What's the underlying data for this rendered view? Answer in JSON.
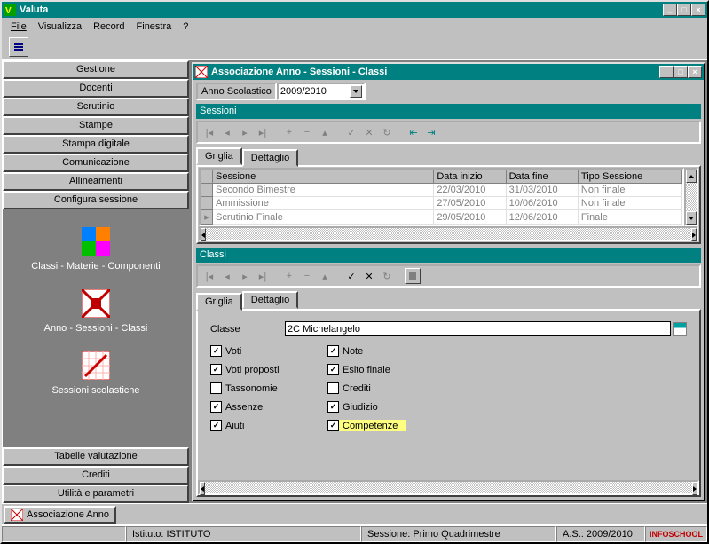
{
  "app": {
    "title": "Valuta"
  },
  "menubar": [
    "File",
    "Visualizza",
    "Record",
    "Finestra",
    "?"
  ],
  "sidebar": {
    "top": [
      "Gestione",
      "Docenti",
      "Scrutinio",
      "Stampe",
      "Stampa digitale",
      "Comunicazione",
      "Allineamenti",
      "Configura sessione"
    ],
    "panel": [
      {
        "label": "Classi - Materie - Componenti"
      },
      {
        "label": "Anno - Sessioni - Classi"
      },
      {
        "label": "Sessioni scolastiche"
      }
    ],
    "bottom": [
      "Tabelle valutazione",
      "Crediti",
      "Utilità e parametri"
    ]
  },
  "child": {
    "title": "Associazione Anno - Sessioni - Classi",
    "year_label": "Anno Scolastico",
    "year_value": "2009/2010",
    "sessioni": {
      "header": "Sessioni",
      "tabs": [
        "Griglia",
        "Dettaglio"
      ],
      "columns": [
        "Sessione",
        "Data inizio",
        "Data fine",
        "Tipo Sessione"
      ],
      "rows": [
        {
          "sessione": "Secondo Bimestre",
          "inizio": "22/03/2010",
          "fine": "31/03/2010",
          "tipo": "Non finale"
        },
        {
          "sessione": "Ammissione",
          "inizio": "27/05/2010",
          "fine": "10/06/2010",
          "tipo": "Non finale"
        },
        {
          "sessione": "Scrutinio Finale",
          "inizio": "29/05/2010",
          "fine": "12/06/2010",
          "tipo": "Finale"
        }
      ]
    },
    "classi": {
      "header": "Classi",
      "tabs": [
        "Griglia",
        "Dettaglio"
      ],
      "classe_label": "Classe",
      "classe_value": "2C Michelangelo",
      "checks_left": [
        {
          "label": "Voti",
          "checked": true
        },
        {
          "label": "Voti proposti",
          "checked": true
        },
        {
          "label": "Tassonomie",
          "checked": false
        },
        {
          "label": "Assenze",
          "checked": true
        },
        {
          "label": "Aiuti",
          "checked": true
        }
      ],
      "checks_right": [
        {
          "label": "Note",
          "checked": true
        },
        {
          "label": "Esito finale",
          "checked": true
        },
        {
          "label": "Crediti",
          "checked": false
        },
        {
          "label": "Giudizio",
          "checked": true
        },
        {
          "label": "Competenze",
          "checked": true,
          "hilite": true
        }
      ]
    }
  },
  "taskbar": {
    "label": "Associazione Anno"
  },
  "status": {
    "istituto": "Istituto: ISTITUTO",
    "sessione": "Sessione: Primo Quadrimestre",
    "as": "A.S.: 2009/2010",
    "brand": "INFOSCHOOL"
  }
}
